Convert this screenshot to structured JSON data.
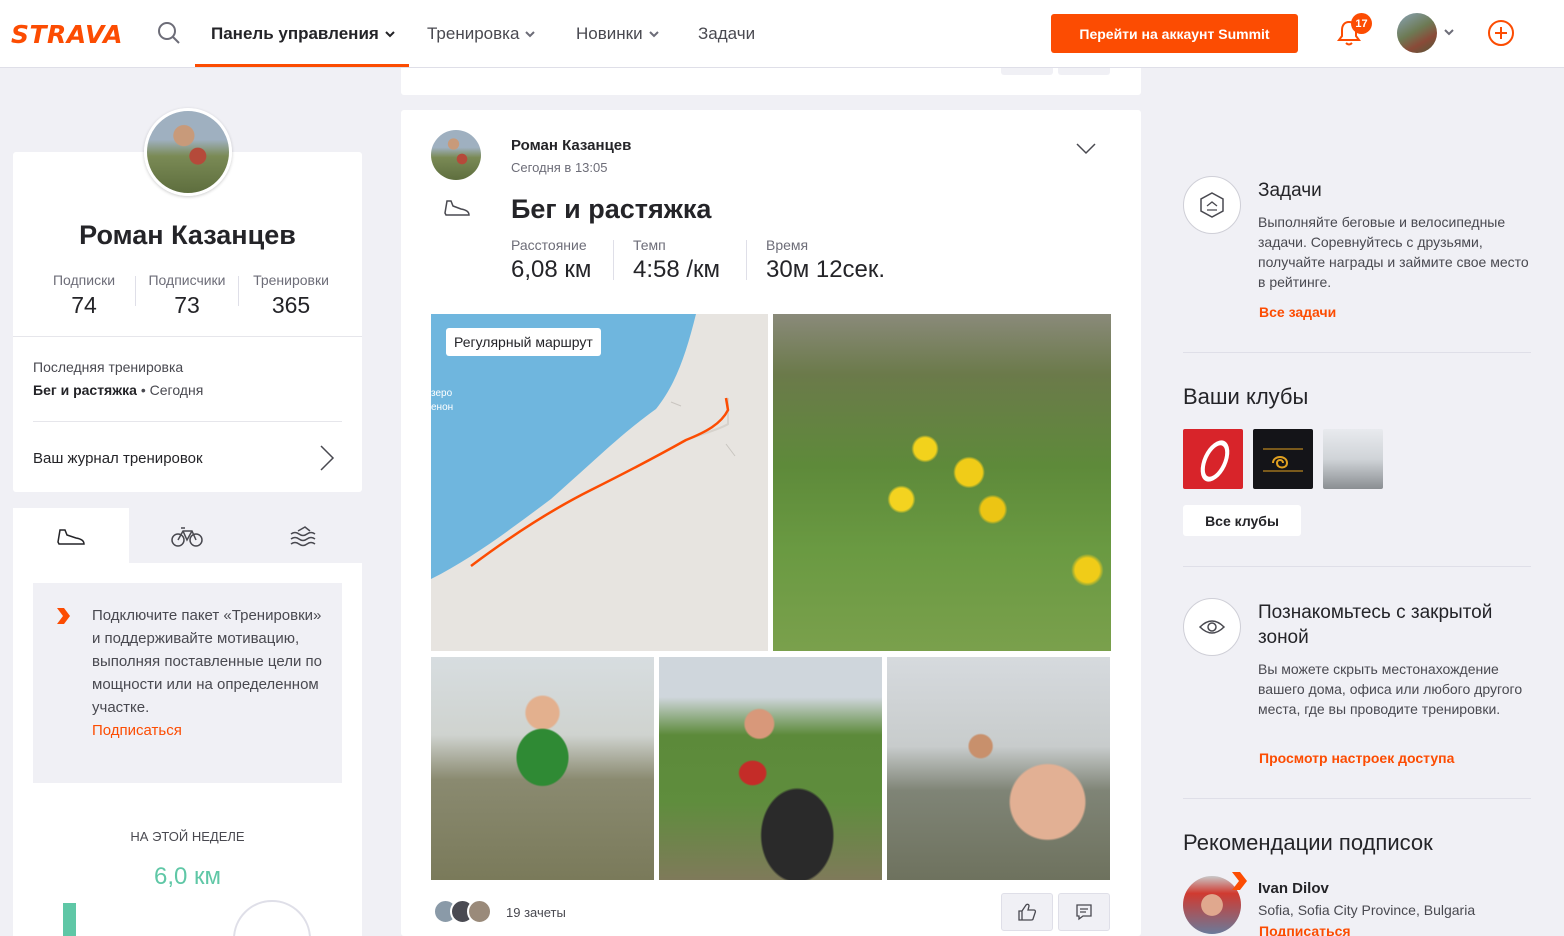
{
  "header": {
    "logo": "STRAVA",
    "nav": [
      {
        "label": "Панель управления"
      },
      {
        "label": "Тренировка"
      },
      {
        "label": "Новинки"
      },
      {
        "label": "Задачи"
      }
    ],
    "summit_button": "Перейти на аккаунт Summit",
    "notifications_count": "17",
    "accent_color": "#fc4c02"
  },
  "profile": {
    "name": "Роман Казанцев",
    "stats": [
      {
        "label": "Подписки",
        "value": "74"
      },
      {
        "label": "Подписчики",
        "value": "73"
      },
      {
        "label": "Тренировки",
        "value": "365"
      }
    ],
    "last_workout_label": "Последняя тренировка",
    "last_workout_name": "Бег и растяжка",
    "last_workout_when": " • Сегодня",
    "journal_link": "Ваш журнал тренировок"
  },
  "sport_tabs": [
    "shoe-icon",
    "bike-icon",
    "swim-icon"
  ],
  "promo": {
    "text": "Подключите пакет «Тренировки» и поддерживайте мотивацию, выполняя поставленные цели по мощности или на определенном участке.",
    "link": "Подписаться"
  },
  "week": {
    "label": "НА ЭТОЙ НЕДЕЛЕ",
    "distance": "6,0 км",
    "color": "#5fc7a6"
  },
  "activity": {
    "athlete": "Роман Казанцев",
    "time": "Сегодня в 13:05",
    "title": "Бег и растяжка",
    "stats": [
      {
        "label": "Расстояние",
        "value": "6,08 км"
      },
      {
        "label": "Темп",
        "value": "4:58 /км"
      },
      {
        "label": "Время",
        "value": "30м 12сек."
      }
    ],
    "map_badge": "Регулярный маршрут",
    "map_label_1": "зеро",
    "map_label_2": "енон",
    "kudos": "19 зачеты"
  },
  "challenges": {
    "title": "Задачи",
    "text": "Выполняйте беговые и велосипедные задачи. Соревнуйтесь с друзьями, получайте награды и займите свое место в рейтинге.",
    "link": "Все задачи"
  },
  "clubs": {
    "title": "Ваши клубы",
    "button": "Все клубы"
  },
  "privacy": {
    "title": "Познакомьтесь с закрытой зоной",
    "text": "Вы можете скрыть местонахождение вашего дома, офиса или любого другого места, где вы проводите тренировки.",
    "link": "Просмотр настроек доступа"
  },
  "recommendations": {
    "title": "Рекомендации подписок",
    "name": "Ivan Dilov",
    "location": "Sofia, Sofia City Province, Bulgaria",
    "link": "Подписаться"
  }
}
